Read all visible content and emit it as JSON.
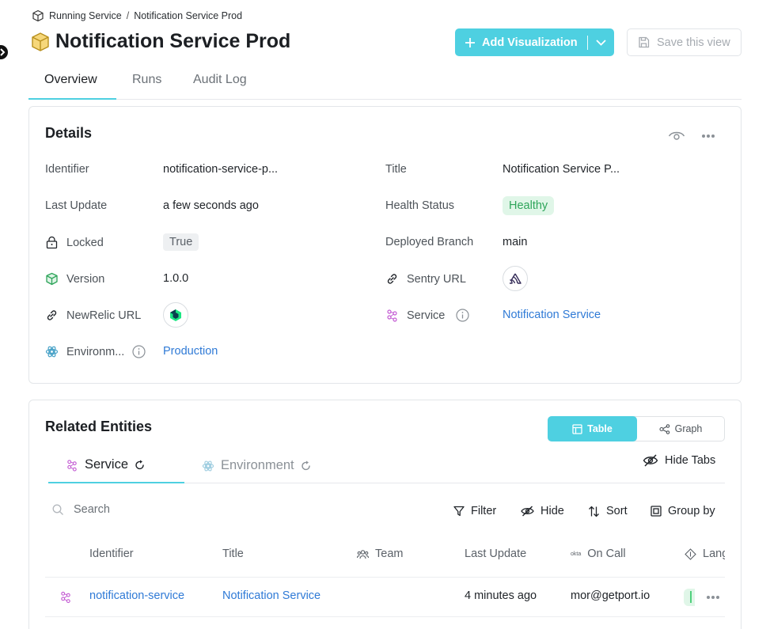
{
  "breadcrumb": {
    "parent": "Running Service",
    "separator": "/",
    "current": "Notification Service Prod"
  },
  "page": {
    "title": "Notification Service Prod"
  },
  "actions": {
    "add_visualization": "Add Visualization",
    "save_view": "Save this view"
  },
  "tabs": [
    {
      "label": "Overview",
      "active": true
    },
    {
      "label": "Runs",
      "active": false
    },
    {
      "label": "Audit Log",
      "active": false
    }
  ],
  "details": {
    "title": "Details",
    "left": {
      "identifier_label": "Identifier",
      "identifier_value": "notification-service-p...",
      "last_update_label": "Last Update",
      "last_update_value": "a few seconds ago",
      "locked_label": "Locked",
      "locked_value": "True",
      "version_label": "Version",
      "version_value": "1.0.0",
      "newrelic_label": "NewRelic URL",
      "environment_label": "Environm...",
      "environment_value": "Production"
    },
    "right": {
      "title_label": "Title",
      "title_value": "Notification Service P...",
      "health_label": "Health Status",
      "health_value": "Healthy",
      "branch_label": "Deployed Branch",
      "branch_value": "main",
      "sentry_label": "Sentry URL",
      "service_label": "Service",
      "service_value": "Notification Service"
    }
  },
  "related": {
    "title": "Related Entities",
    "view_toggle": {
      "table": "Table",
      "graph": "Graph",
      "selected": "Table"
    },
    "tabs": [
      {
        "label": "Service",
        "active": true
      },
      {
        "label": "Environment",
        "active": false
      }
    ],
    "hide_tabs": "Hide Tabs",
    "search_placeholder": "Search",
    "toolbar": {
      "filter": "Filter",
      "hide": "Hide",
      "sort": "Sort",
      "group_by": "Group by"
    },
    "columns": [
      "Identifier",
      "Title",
      "Team",
      "Last Update",
      "On Call",
      "Lang"
    ],
    "on_call_prefix": "okta",
    "rows": [
      {
        "identifier": "notification-service",
        "title": "Notification Service",
        "team": "",
        "last_update": "4 minutes ago",
        "on_call": "mor@getport.io"
      }
    ]
  },
  "colors": {
    "accent": "#4ed0e1",
    "link": "#2f7ad6",
    "healthy_bg": "#e0f6e8",
    "healthy_text": "#2ea55a"
  }
}
